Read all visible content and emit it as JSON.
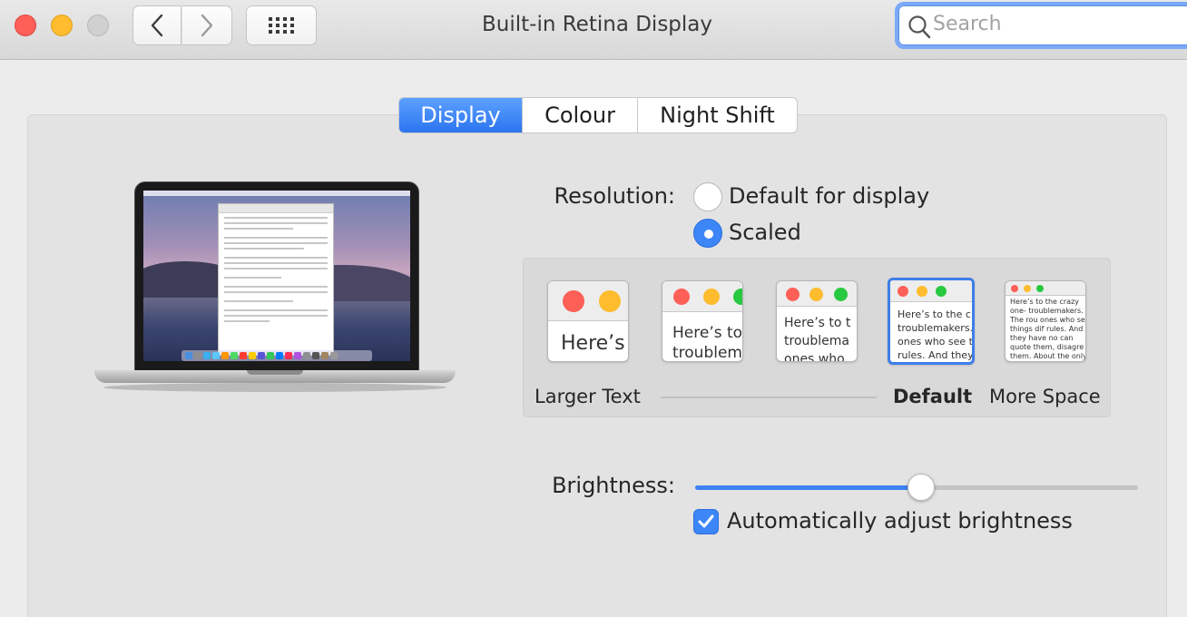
{
  "window": {
    "title": "Built-in Retina Display",
    "search_placeholder": "Search"
  },
  "toolbar": {
    "back_icon": "chevron-left-icon",
    "forward_icon": "chevron-right-icon",
    "grid_icon": "grid-icon"
  },
  "tabs": [
    {
      "label": "Display",
      "selected": true
    },
    {
      "label": "Colour",
      "selected": false
    },
    {
      "label": "Night Shift",
      "selected": false
    }
  ],
  "resolution": {
    "label": "Resolution:",
    "options": [
      {
        "label": "Default for display",
        "selected": false
      },
      {
        "label": "Scaled",
        "selected": true
      }
    ]
  },
  "scaling": {
    "previews": [
      {
        "text": "Here’s",
        "selected": false
      },
      {
        "text": "Here’s to troublem",
        "selected": false
      },
      {
        "text": "Here’s to t troublema ones who",
        "selected": false
      },
      {
        "text": "Here’s to the cr troublemakers. ones who see t rules. And they",
        "selected": true
      },
      {
        "text": "Here’s to the crazy one- troublemakers. The rou ones who see things dif rules. And they have no can quote them, disagre them. About the only th Because they change t",
        "selected": false
      }
    ],
    "left_label": "Larger Text",
    "default_label": "Default",
    "right_label": "More Space"
  },
  "brightness": {
    "label": "Brightness:",
    "level": 0.51,
    "auto_adjust_label": "Automatically adjust brightness",
    "auto_adjust_checked": true
  },
  "colors": {
    "accent": "#3c86f7",
    "close": "#fe5f57",
    "minimize": "#febc2e",
    "zoom_inactive": "#d0d0d0"
  }
}
